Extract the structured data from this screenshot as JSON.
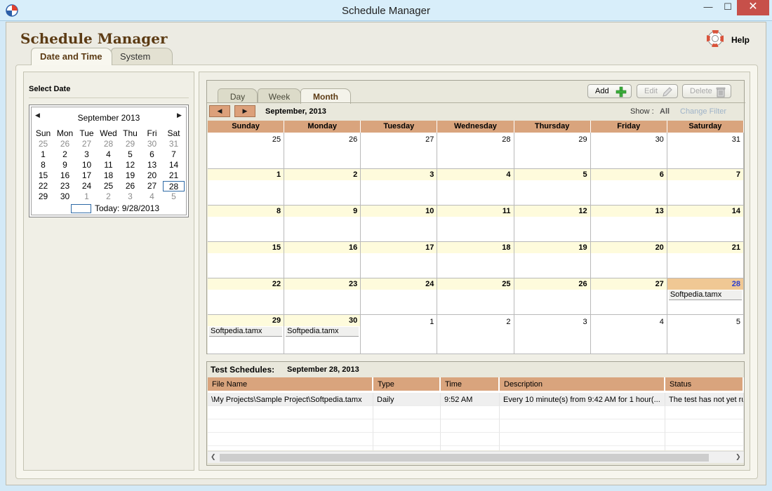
{
  "window": {
    "title": "Schedule Manager",
    "min_glyph": "—",
    "max_glyph": "☐",
    "close_glyph": "✕"
  },
  "app": {
    "title": "Schedule Manager",
    "help_label": "Help",
    "help_icon": "lifebuoy-icon"
  },
  "main_tabs": [
    {
      "label": "Date and Time",
      "active": true
    },
    {
      "label": "System",
      "active": false
    }
  ],
  "left": {
    "heading": "Select Date",
    "calendar": {
      "month_label": "September 2013",
      "prev_glyph": "◀",
      "next_glyph": "▶",
      "weekdays": [
        "Sun",
        "Mon",
        "Tue",
        "Wed",
        "Thu",
        "Fri",
        "Sat"
      ],
      "weeks": [
        [
          "25",
          "26",
          "27",
          "28",
          "29",
          "30",
          "31"
        ],
        [
          "1",
          "2",
          "3",
          "4",
          "5",
          "6",
          "7"
        ],
        [
          "8",
          "9",
          "10",
          "11",
          "12",
          "13",
          "14"
        ],
        [
          "15",
          "16",
          "17",
          "18",
          "19",
          "20",
          "21"
        ],
        [
          "22",
          "23",
          "24",
          "25",
          "26",
          "27",
          "28"
        ],
        [
          "29",
          "30",
          "1",
          "2",
          "3",
          "4",
          "5"
        ]
      ],
      "selected": "28",
      "today_label": "Today: 9/28/2013"
    }
  },
  "view_tabs": [
    {
      "label": "Day",
      "active": false
    },
    {
      "label": "Week",
      "active": false
    },
    {
      "label": "Month",
      "active": true
    }
  ],
  "toolbar": {
    "add_label": "Add",
    "edit_label": "Edit",
    "delete_label": "Delete"
  },
  "month_view": {
    "prev_glyph": "◀",
    "next_glyph": "▶",
    "month_label": "September, 2013",
    "show_label": "Show :",
    "show_value": "All",
    "change_filter_label": "Change Filter",
    "weekdays": [
      "Sunday",
      "Monday",
      "Tuesday",
      "Wednesday",
      "Thursday",
      "Friday",
      "Saturday"
    ],
    "weeks": [
      [
        "25",
        "26",
        "27",
        "28",
        "29",
        "30",
        "31"
      ],
      [
        "1",
        "2",
        "3",
        "4",
        "5",
        "6",
        "7"
      ],
      [
        "8",
        "9",
        "10",
        "11",
        "12",
        "13",
        "14"
      ],
      [
        "15",
        "16",
        "17",
        "18",
        "19",
        "20",
        "21"
      ],
      [
        "22",
        "23",
        "24",
        "25",
        "26",
        "27",
        "28"
      ],
      [
        "29",
        "30",
        "1",
        "2",
        "3",
        "4",
        "5"
      ]
    ],
    "today": "28",
    "events": [
      {
        "week": 4,
        "day": 6,
        "label": "Softpedia.tamx"
      },
      {
        "week": 5,
        "day": 0,
        "label": "Softpedia.tamx"
      },
      {
        "week": 5,
        "day": 1,
        "label": "Softpedia.tamx"
      }
    ]
  },
  "schedules": {
    "title": "Test Schedules:",
    "date": "September 28, 2013",
    "columns": [
      "File Name",
      "Type",
      "Time",
      "Description",
      "Status"
    ],
    "rows": [
      [
        "\\My Projects\\Sample Project\\Softpedia.tamx",
        "Daily",
        "9:52 AM",
        "Every 10 minute(s) from 9:42 AM for 1 hour(...",
        "The test has not yet run"
      ]
    ]
  },
  "colors": {
    "header_brown": "#5c3b14",
    "weekday_header": "#d9a47d",
    "current_band": "#fefbdc",
    "today_band": "#f0c894"
  }
}
